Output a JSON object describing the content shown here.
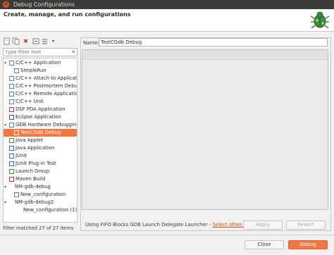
{
  "window": {
    "title": "Debug Configurations"
  },
  "header": {
    "text": "Create, manage, and run configurations"
  },
  "toolbar": {
    "icons": [
      "new-config-icon",
      "duplicate-icon",
      "delete-icon",
      "collapse-all-icon",
      "filter-icon",
      "dropdown-icon"
    ]
  },
  "filter": {
    "placeholder": "type filter text",
    "clear_glyph": "✕"
  },
  "tree": [
    {
      "label": "C/C++ Application",
      "level": 0,
      "toggle": "▾",
      "icon": "c-app-icon",
      "color": "#5a7fb5"
    },
    {
      "label": "SimpleRun",
      "level": 1,
      "toggle": "",
      "icon": "c-app-icon",
      "color": "#5a7fb5"
    },
    {
      "label": "C/C++ Attach to Applicat",
      "level": 0,
      "toggle": "",
      "icon": "c-attach-icon",
      "color": "#5a7fb5"
    },
    {
      "label": "C/C++ Postmortem Debu",
      "level": 0,
      "toggle": "",
      "icon": "c-postmortem-icon",
      "color": "#5a7fb5"
    },
    {
      "label": "C/C++ Remote Applicatio",
      "level": 0,
      "toggle": "",
      "icon": "c-remote-icon",
      "color": "#5a7fb5"
    },
    {
      "label": "C/C++ Unit",
      "level": 0,
      "toggle": "",
      "icon": "c-unit-icon",
      "color": "#5a7fb5"
    },
    {
      "label": "DSF PDA Application",
      "level": 0,
      "toggle": "",
      "icon": "dsf-icon",
      "color": "#7a3f9e"
    },
    {
      "label": "Eclipse Application",
      "level": 0,
      "toggle": "",
      "icon": "eclipse-icon",
      "color": "#3d4c8c"
    },
    {
      "label": "GDB Hardware Debuggin",
      "level": 0,
      "toggle": "▾",
      "icon": "gdb-icon",
      "color": "#5a7fb5"
    },
    {
      "label": "TestCGdb Debug",
      "level": 1,
      "toggle": "",
      "icon": "c-app-icon",
      "color": "#ffffff",
      "selected": true
    },
    {
      "label": "Java Applet",
      "level": 0,
      "toggle": "",
      "icon": "java-applet-icon",
      "color": "#4a8d3b"
    },
    {
      "label": "Java Application",
      "level": 0,
      "toggle": "",
      "icon": "java-app-icon",
      "color": "#2a6fb8"
    },
    {
      "label": "JUnit",
      "level": 0,
      "toggle": "",
      "icon": "junit-icon",
      "color": "#2a6fb8"
    },
    {
      "label": "JUnit Plug-in Test",
      "level": 0,
      "toggle": "",
      "icon": "junit-plugin-icon",
      "color": "#2a6fb8"
    },
    {
      "label": "Launch Group",
      "level": 0,
      "toggle": "",
      "icon": "launch-group-icon",
      "color": "#3a8f3a"
    },
    {
      "label": "Maven Build",
      "level": 0,
      "toggle": "",
      "icon": "maven-icon",
      "color": "#c03030"
    },
    {
      "label": "NM-gdb-debug",
      "level": 0,
      "toggle": "▾",
      "icon": "",
      "color": "#777777"
    },
    {
      "label": "New_configuration",
      "level": 1,
      "toggle": "",
      "icon": "config-icon",
      "color": "#777777"
    },
    {
      "label": "NM-gdb-debug2",
      "level": 0,
      "toggle": "▾",
      "icon": "",
      "color": "#777777"
    },
    {
      "label": "New_configuration (1)",
      "level": 1,
      "toggle": "",
      "icon": "",
      "color": "#777777"
    }
  ],
  "status": {
    "filter_text": "Filter matched 27 of 27 items"
  },
  "config": {
    "name_label": "Name:",
    "name_value": "TestCGdb Debug"
  },
  "launcher": {
    "text": "Using FIFO Blocks GDB Launch Delegate Launcher - ",
    "link": "Select other..."
  },
  "buttons": {
    "apply": "Apply",
    "revert": "Revert",
    "close": "Close",
    "debug": "Debug"
  },
  "colors": {
    "accent": "#f07746",
    "titlebar": "#3c3b37",
    "link": "#c2511d"
  }
}
